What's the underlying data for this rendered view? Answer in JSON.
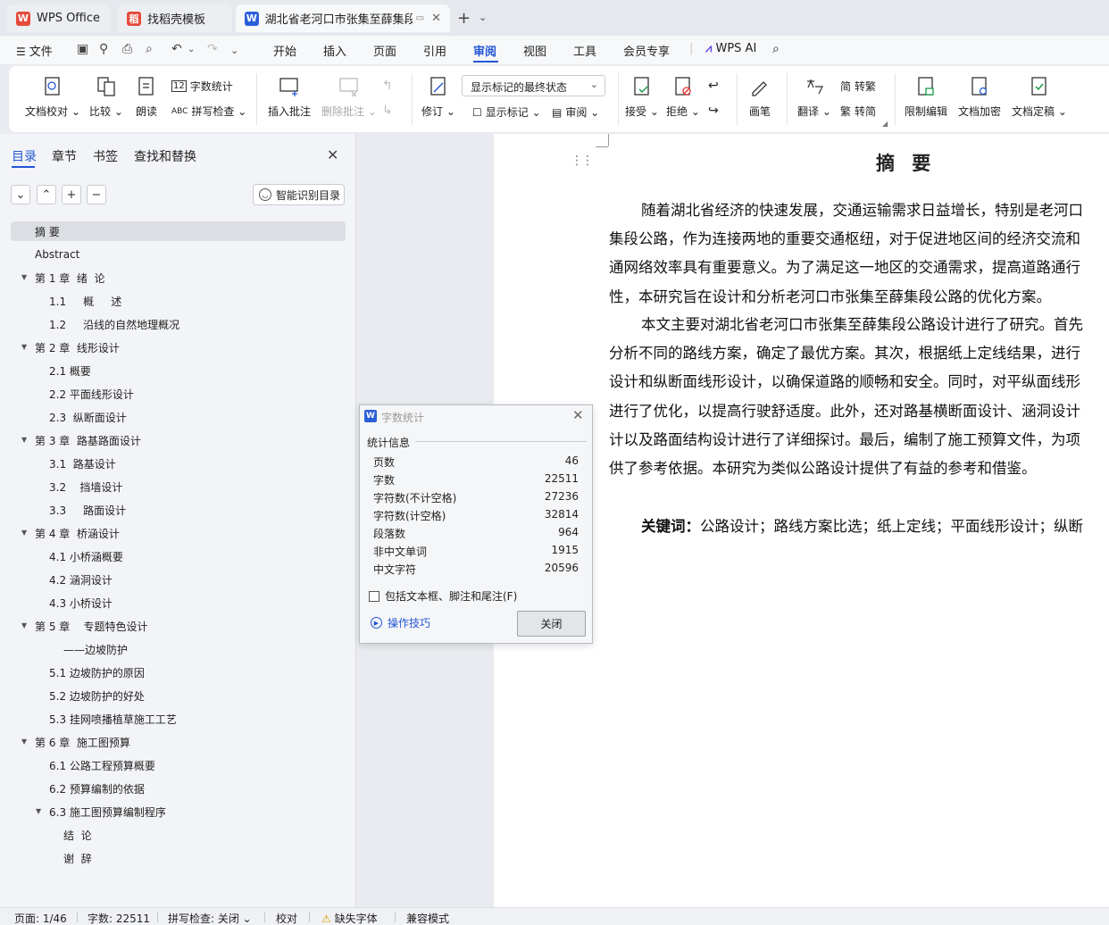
{
  "tabs": [
    {
      "label": "WPS Office",
      "logo": "W",
      "color": "#e64a3b"
    },
    {
      "label": "找稻壳模板",
      "logo": "稻",
      "color": "#e64a3b"
    },
    {
      "label": "湖北省老河口市张集至薛集段公",
      "logo": "W",
      "color": "#2b5fd9"
    }
  ],
  "menu": {
    "file": "文件",
    "items": [
      "开始",
      "插入",
      "页面",
      "引用",
      "审阅",
      "视图",
      "工具",
      "会员专享"
    ],
    "active": "审阅",
    "wps_ai": "WPS AI"
  },
  "ribbon": {
    "doc_check": "文档校对",
    "compare": "比较",
    "read_aloud": "朗读",
    "word_count": "字数统计",
    "spell_check": "拼写检查",
    "insert_comment": "插入批注",
    "delete_comment": "删除批注",
    "track": "修订",
    "markup_state": "显示标记的最终状态",
    "show_markup": "显示标记",
    "review_pane": "审阅",
    "accept": "接受",
    "reject": "拒绝",
    "ink": "画笔",
    "translate": "翻译",
    "to_traditional": "转繁",
    "to_simplified": "转简",
    "restrict_edit": "限制编辑",
    "doc_encrypt": "文档加密",
    "doc_finalize": "文档定稿"
  },
  "panel": {
    "tabs": [
      "目录",
      "章节",
      "书签",
      "查找和替换"
    ],
    "smart_toc": "智能识别目录",
    "toc": [
      {
        "text": "摘 要",
        "level": 1,
        "arrow": false,
        "selected": true
      },
      {
        "text": "Abstract",
        "level": 1,
        "arrow": false
      },
      {
        "text": "第 1 章  绪  论",
        "level": 1,
        "arrow": true
      },
      {
        "text": "1.1     概     述",
        "level": 2,
        "arrow": false
      },
      {
        "text": "1.2     沿线的自然地理概况",
        "level": 2,
        "arrow": false
      },
      {
        "text": "第 2 章  线形设计",
        "level": 1,
        "arrow": true
      },
      {
        "text": "2.1 概要",
        "level": 2,
        "arrow": false
      },
      {
        "text": "2.2 平面线形设计",
        "level": 2,
        "arrow": false
      },
      {
        "text": "2.3  纵断面设计",
        "level": 2,
        "arrow": false
      },
      {
        "text": "第 3 章  路基路面设计",
        "level": 1,
        "arrow": true
      },
      {
        "text": "3.1  路基设计",
        "level": 2,
        "arrow": false
      },
      {
        "text": "3.2    挡墙设计",
        "level": 2,
        "arrow": false
      },
      {
        "text": "3.3     路面设计",
        "level": 2,
        "arrow": false
      },
      {
        "text": "第 4 章  桥涵设计",
        "level": 1,
        "arrow": true
      },
      {
        "text": "4.1 小桥涵概要",
        "level": 2,
        "arrow": false
      },
      {
        "text": "4.2 涵洞设计",
        "level": 2,
        "arrow": false
      },
      {
        "text": "4.3 小桥设计",
        "level": 2,
        "arrow": false
      },
      {
        "text": "第 5 章    专题特色设计",
        "level": 1,
        "arrow": true
      },
      {
        "text": "——边坡防护",
        "level": 3,
        "arrow": false
      },
      {
        "text": "5.1 边坡防护的原因",
        "level": 2,
        "arrow": false
      },
      {
        "text": "5.2 边坡防护的好处",
        "level": 2,
        "arrow": false
      },
      {
        "text": "5.3 挂网喷播植草施工工艺",
        "level": 2,
        "arrow": false
      },
      {
        "text": "第 6 章  施工图预算",
        "level": 1,
        "arrow": true
      },
      {
        "text": "6.1 公路工程预算概要",
        "level": 2,
        "arrow": false
      },
      {
        "text": "6.2 预算编制的依据",
        "level": 2,
        "arrow": false
      },
      {
        "text": "6.3 施工图预算编制程序",
        "level": 2,
        "arrow": true
      },
      {
        "text": "结  论",
        "level": 3,
        "arrow": false
      },
      {
        "text": "谢  辞",
        "level": 3,
        "arrow": false
      }
    ]
  },
  "document": {
    "title": "摘  要",
    "para1": [
      "随着湖北省经济的快速发展，交通运输需求日益增长，特别是老河口",
      "集段公路，作为连接两地的重要交通枢纽，对于促进地区间的经济交流和",
      "通网络效率具有重要意义。为了满足这一地区的交通需求，提高道路通行",
      "性，本研究旨在设计和分析老河口市张集至薛集段公路的优化方案。"
    ],
    "para2": [
      "本文主要对湖北省老河口市张集至薛集段公路设计进行了研究。首先",
      "分析不同的路线方案，确定了最优方案。其次，根据纸上定线结果，进行",
      "设计和纵断面线形设计，以确保道路的顺畅和安全。同时，对平纵面线形",
      "进行了优化，以提高行驶舒适度。此外，还对路基横断面设计、涵洞设计",
      "计以及路面结构设计进行了详细探讨。最后，编制了施工预算文件，为项",
      "供了参考依据。本研究为类似公路设计提供了有益的参考和借鉴。"
    ],
    "keywords_label": "关键词：",
    "keywords": "公路设计；路线方案比选；纸上定线；平面线形设计；纵断"
  },
  "dialog": {
    "title": "字数统计",
    "section": "统计信息",
    "stats": [
      {
        "label": "页数",
        "value": "46"
      },
      {
        "label": "字数",
        "value": "22511"
      },
      {
        "label": "字符数(不计空格)",
        "value": "27236"
      },
      {
        "label": "字符数(计空格)",
        "value": "32814"
      },
      {
        "label": "段落数",
        "value": "964"
      },
      {
        "label": "非中文单词",
        "value": "1915"
      },
      {
        "label": "中文字符",
        "value": "20596"
      }
    ],
    "checkbox": "包括文本框、脚注和尾注(F)",
    "tips": "操作技巧",
    "close": "关闭"
  },
  "status": {
    "page": "页面: 1/46",
    "words": "字数: 22511",
    "spell": "拼写检查: 关闭",
    "proof": "校对",
    "missing_font": "缺失字体",
    "compat": "兼容模式"
  }
}
